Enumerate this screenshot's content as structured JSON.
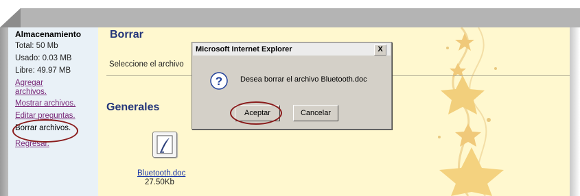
{
  "sidebar": {
    "title": "Almacenamiento",
    "total": "Total: 50 Mb",
    "used": "Usado: 0.03 MB",
    "free": "Libre: 49.97 MB",
    "links": {
      "add_line1": "Agregar",
      "add_line2": "archivos.",
      "show": "Mostrar archivos.",
      "edit": "Editar preguntas.",
      "delete": "Borrar archivos.",
      "back": "Regresar."
    }
  },
  "main": {
    "title": "Borrar",
    "select_text": "Seleccione el archivo",
    "section_title": "Generales",
    "file": {
      "name": "Bluetooth.doc",
      "size": "27.50Kb"
    }
  },
  "dialog": {
    "title": "Microsoft Internet Explorer",
    "close_label": "X",
    "message": "Desea borrar el archivo Bluetooth.doc",
    "ok_label": "Aceptar",
    "cancel_label": "Cancelar",
    "icon": "question-icon"
  },
  "colors": {
    "page_bg": "#fff8cf",
    "sidebar_bg": "#e9f1f7",
    "heading": "#23357a",
    "link": "#7a2a7a",
    "highlight_ellipse": "#8a1c1c"
  }
}
